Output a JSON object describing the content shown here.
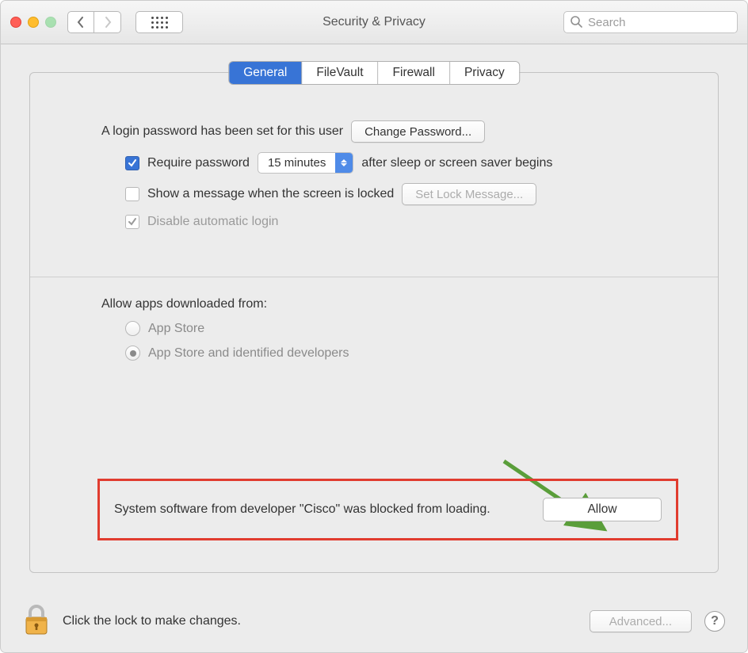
{
  "window": {
    "title": "Security & Privacy",
    "search_placeholder": "Search"
  },
  "tabs": {
    "items": [
      "General",
      "FileVault",
      "Firewall",
      "Privacy"
    ],
    "active_index": 0
  },
  "general": {
    "login_msg": "A login password has been set for this user",
    "change_password_btn": "Change Password...",
    "require_pw_label": "Require password",
    "delay_value": "15 minutes",
    "after_sleep_label": "after sleep or screen saver begins",
    "show_message_label": "Show a message when the screen is locked",
    "set_lock_msg_btn": "Set Lock Message...",
    "disable_auto_login_label": "Disable automatic login",
    "checkboxes": {
      "require_password": true,
      "show_message": false,
      "disable_auto_login": true
    }
  },
  "gatekeeper": {
    "heading": "Allow apps downloaded from:",
    "options": [
      "App Store",
      "App Store and identified developers"
    ],
    "selected_index": 1
  },
  "blocked": {
    "message": "System software from developer \"Cisco\" was blocked from loading.",
    "allow_btn": "Allow"
  },
  "footer": {
    "lock_msg": "Click the lock to make changes.",
    "advanced_btn": "Advanced..."
  }
}
